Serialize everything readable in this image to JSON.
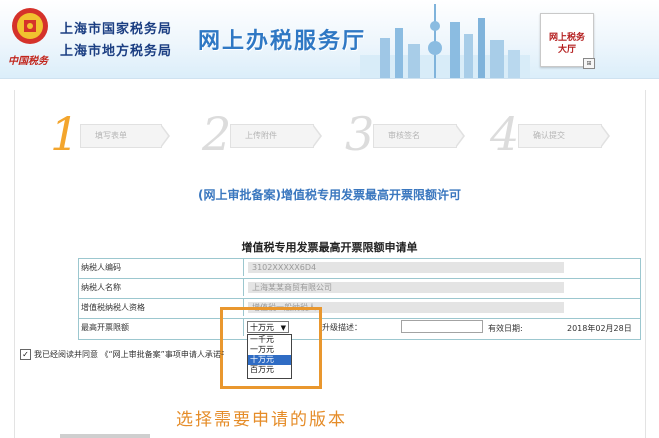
{
  "header": {
    "emblem_text": "中国税务",
    "org_line1": "上海市国家税务局",
    "org_line2": "上海市地方税务局",
    "site_title": "网上办税服务厅",
    "hall_badge_line1": "网上税务",
    "hall_badge_line2": "大厅"
  },
  "steps": [
    {
      "num": "1",
      "label": "填写表单",
      "active": true
    },
    {
      "num": "2",
      "label": "上传附件",
      "active": false
    },
    {
      "num": "3",
      "label": "审核签名",
      "active": false
    },
    {
      "num": "4",
      "label": "确认提交",
      "active": false
    }
  ],
  "form_title": "(网上审批备案)增值税专用发票最高开票限额许可",
  "table_title": "增值税专用发票最高开票限额申请单",
  "rows": [
    {
      "label": "纳税人编码",
      "value": "3102XXXXX6D4"
    },
    {
      "label": "纳税人名称",
      "value": "上海某某商贸有限公司"
    },
    {
      "label": "增值税纳税人资格",
      "value": "增值税一般纳税人"
    }
  ],
  "limit_row": {
    "label": "最高开票限额",
    "selected": "十万元",
    "upgrade_label": "升级描述：",
    "effective_label": "有效日期:",
    "effective_date": "2018年02月28日"
  },
  "dropdown_options": [
    "一千元",
    "一万元",
    "十万元",
    "百万元"
  ],
  "dropdown_highlight_index": 2,
  "agree_text": "我已经阅读并同意 《“网上审批备案”事项申请人承诺书》",
  "caption": "选择需要申请的版本",
  "colors": {
    "step_active": "#f3a52d",
    "title_blue": "#3a77bf",
    "highlight_orange": "#e9972e"
  }
}
